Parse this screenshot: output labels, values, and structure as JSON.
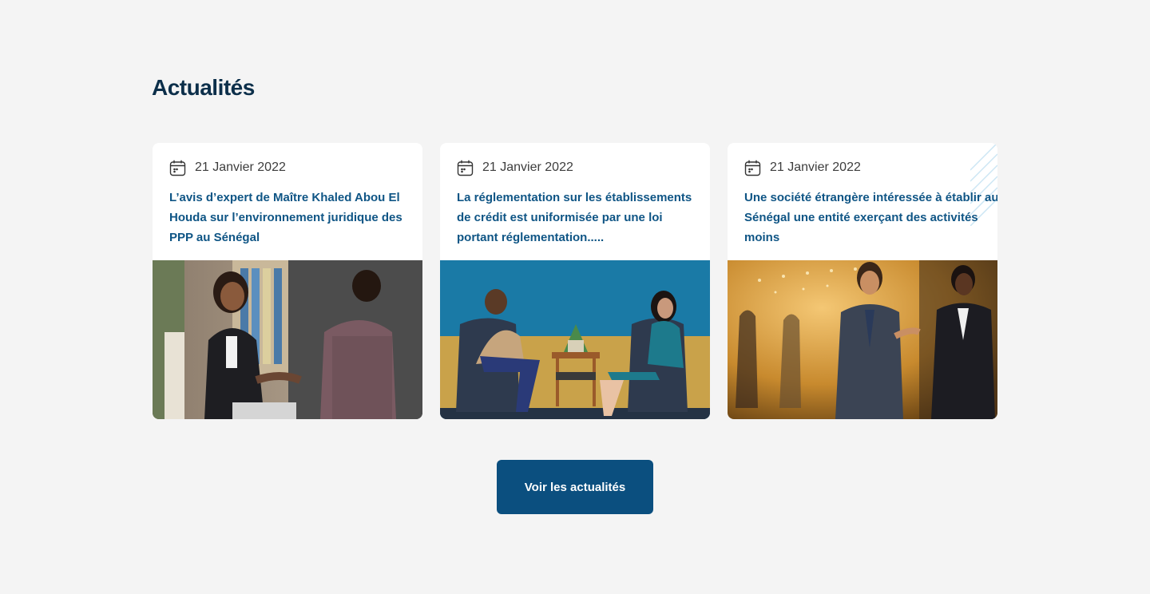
{
  "section": {
    "title": "Actualités"
  },
  "articles": [
    {
      "date": "21 Janvier 2022",
      "title": "L’avis d’expert de Maître Khaled Abou El Houda sur l’environnement juridique des PPP au Sénégal",
      "image_icon": "handshake-photo"
    },
    {
      "date": "21 Janvier 2022",
      "title": "La réglementation sur les établissements de crédit est uniformisée par une loi portant réglementation.....",
      "image_icon": "meeting-photo"
    },
    {
      "date": "21 Janvier 2022",
      "title": "Une société étrangère intéressée à établir au Sénégal une entité exerçant des activités moins",
      "image_icon": "business-talk-photo"
    }
  ],
  "cta": {
    "label": "Voir les actualités"
  },
  "colors": {
    "background": "#f4f4f4",
    "heading": "#0c2f4a",
    "article_title": "#0f5585",
    "button": "#0b4f7f"
  }
}
